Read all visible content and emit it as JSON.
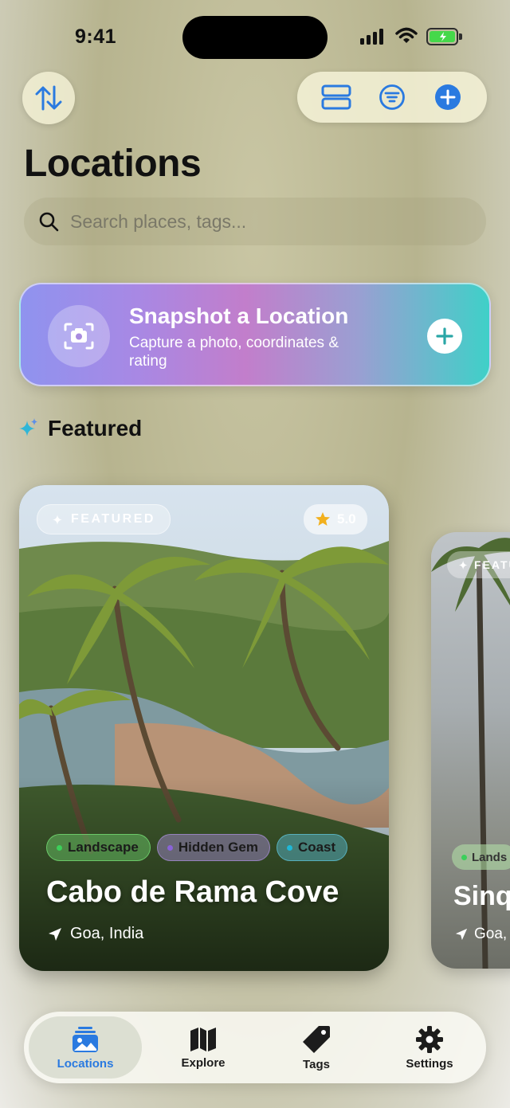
{
  "status_bar": {
    "time": "9:41"
  },
  "header": {
    "title": "Locations"
  },
  "search": {
    "placeholder": "Search places, tags..."
  },
  "snapshot": {
    "title": "Snapshot a Location",
    "subtitle": "Capture a photo, coordinates & rating"
  },
  "featured_section": {
    "title": "Featured"
  },
  "cards": [
    {
      "badge": "FEATURED",
      "rating": "5.0",
      "tags": [
        {
          "label": "Landscape",
          "color": "#3ccf5a"
        },
        {
          "label": "Hidden Gem",
          "color": "#8a63d8"
        },
        {
          "label": "Coast",
          "color": "#1fb7d6"
        }
      ],
      "name": "Cabo de Rama Cove",
      "location": "Goa, India"
    },
    {
      "badge": "FEATU",
      "tag": "Lands",
      "name": "Sinq",
      "location": "Goa, I"
    }
  ],
  "tabs": [
    {
      "label": "Locations",
      "icon": "photo-stack-icon",
      "active": true
    },
    {
      "label": "Explore",
      "icon": "map-icon"
    },
    {
      "label": "Tags",
      "icon": "tag-icon"
    },
    {
      "label": "Settings",
      "icon": "gear-icon"
    }
  ],
  "colors": {
    "accent": "#2a7ae0",
    "star": "#f2b01e"
  }
}
